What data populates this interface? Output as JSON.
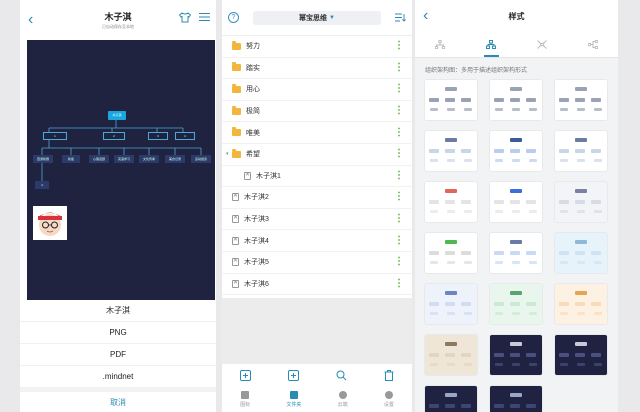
{
  "screen1": {
    "title": "木子淇",
    "subtitle": "已自动保存至本地",
    "mindmap": {
      "root": "木子淇",
      "level1": [
        "1",
        "2",
        "3",
        "4"
      ],
      "level2": [
        "西游新剧",
        "新星",
        "心理话题",
        "英语学习",
        "文化传承",
        "美食记录",
        "运动健身"
      ],
      "level3": [
        "4"
      ]
    },
    "export_options": [
      "木子淇",
      "PNG",
      "PDF",
      ".mindnet"
    ],
    "cancel_label": "取消"
  },
  "screen2": {
    "title": "幂宝思维",
    "items": [
      {
        "type": "folder",
        "name": "努力"
      },
      {
        "type": "folder",
        "name": "踏实"
      },
      {
        "type": "folder",
        "name": "用心"
      },
      {
        "type": "folder",
        "name": "极简"
      },
      {
        "type": "folder",
        "name": "唯美"
      },
      {
        "type": "folder-open",
        "name": "希望"
      },
      {
        "type": "file-nested",
        "name": "木子淇1"
      },
      {
        "type": "file",
        "name": "木子淇2"
      },
      {
        "type": "file",
        "name": "木子淇3"
      },
      {
        "type": "file",
        "name": "木子淇4"
      },
      {
        "type": "file",
        "name": "木子淇5"
      },
      {
        "type": "file",
        "name": "木子淇6"
      }
    ],
    "tabs": [
      {
        "label": "图标",
        "active": false
      },
      {
        "label": "文件夹",
        "active": true
      },
      {
        "label": "云端",
        "active": false
      },
      {
        "label": "设置",
        "active": false
      }
    ]
  },
  "screen3": {
    "title": "样式",
    "description": "组织架构图：多用于描述组织架构形式",
    "accent": "#2a8cb3",
    "thumbnails": [
      {
        "bg": "#ffffff",
        "node": "#9aa3b5",
        "top": "#9aa3b5"
      },
      {
        "bg": "#ffffff",
        "node": "#9aa3b5",
        "top": "#9aa3b5"
      },
      {
        "bg": "#ffffff",
        "node": "#9aa3b5",
        "top": "#9aa3b5"
      },
      {
        "bg": "#ffffff",
        "node": "#c9d6ea",
        "top": "#6c7da3"
      },
      {
        "bg": "#ffffff",
        "node": "#b8cdf0",
        "top": "#3d5a9a"
      },
      {
        "bg": "#ffffff",
        "node": "#c9d6ea",
        "top": "#6c7da3"
      },
      {
        "bg": "#ffffff",
        "node": "#e4e4e4",
        "top": "#e0655b"
      },
      {
        "bg": "#ffffff",
        "node": "#e4e4e4",
        "top": "#3d6fd9"
      },
      {
        "bg": "#f3f4f8",
        "node": "#d8dbe6",
        "top": "#7a7fa5"
      },
      {
        "bg": "#ffffff",
        "node": "#dcdcdc",
        "top": "#50b84f"
      },
      {
        "bg": "#ffffff",
        "node": "#c8daf5",
        "top": "#6a7aa8"
      },
      {
        "bg": "#e7f3fb",
        "node": "#cfe3f2",
        "top": "#8eb8d8"
      },
      {
        "bg": "#eef2fa",
        "node": "#cfdcf1",
        "top": "#6d86c2"
      },
      {
        "bg": "#e9f6ee",
        "node": "#c9eacf",
        "top": "#5aa46f"
      },
      {
        "bg": "#fdf1e3",
        "node": "#f6dcb8",
        "top": "#e4a452"
      },
      {
        "bg": "#efe6d8",
        "node": "#e2d6c2",
        "top": "#8b7a62"
      },
      {
        "bg": "#1f2240",
        "node": "#4a5080",
        "top": "#c8c8d8"
      },
      {
        "bg": "#1f2240",
        "node": "#4a5080",
        "top": "#c8c8d8"
      },
      {
        "bg": "#1f2240",
        "node": "#3d4670",
        "top": "#9aa6c8"
      },
      {
        "bg": "#1f2240",
        "node": "#3d4670",
        "top": "#9aa6c8"
      }
    ]
  }
}
